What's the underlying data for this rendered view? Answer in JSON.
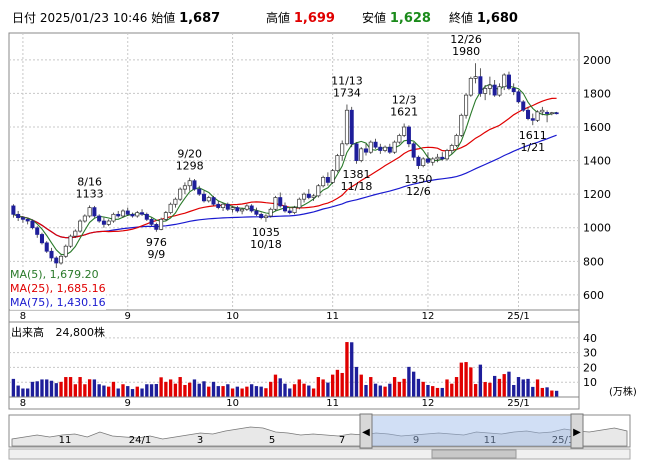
{
  "header": {
    "date_label": "日付",
    "datetime": "2025/01/23 10:46",
    "open_label": "始値",
    "open": "1,687",
    "high_label": "高値",
    "high": "1,699",
    "low_label": "安値",
    "low": "1,628",
    "close_label": "終値",
    "close": "1,680"
  },
  "colors": {
    "up": "#e00000",
    "down": "#1e1e9a",
    "ma5": "#2a7a2a",
    "ma25": "#e00000",
    "ma75": "#1a1ad0",
    "grid": "#c8c8c8",
    "high_value": "#e00000",
    "low_value": "#1a8a1a"
  },
  "chart_data": [
    {
      "type": "candlestick",
      "y_ticks": [
        "2000",
        "1800",
        "1600",
        "1400",
        "1200",
        "1000",
        "800",
        "600"
      ],
      "ylim": [
        510,
        2160
      ],
      "x_ticks": [
        "8",
        "9",
        "10",
        "11",
        "12",
        "25/1"
      ],
      "legend": [
        {
          "name": "MA(5)",
          "value": "1,679.20"
        },
        {
          "name": "MA(25)",
          "value": "1,685.16"
        },
        {
          "name": "MA(75)",
          "value": "1,430.16"
        }
      ],
      "annotations": [
        {
          "date": "8/16",
          "value": "1133"
        },
        {
          "date": "9/9",
          "value": "976"
        },
        {
          "date": "9/20",
          "value": "1298"
        },
        {
          "date": "10/18",
          "value": "1035"
        },
        {
          "date": "11/13",
          "value": "1734"
        },
        {
          "date": "11/18",
          "value": "1381"
        },
        {
          "date": "12/3",
          "value": "1621"
        },
        {
          "date": "12/6",
          "value": "1350"
        },
        {
          "date": "12/26",
          "value": "1980"
        },
        {
          "date": "1/21",
          "value": "1611"
        }
      ],
      "n_sessions": 115,
      "ohlc": [
        [
          1130,
          1140,
          1060,
          1080
        ],
        [
          1080,
          1100,
          1040,
          1060
        ],
        [
          1060,
          1070,
          1030,
          1050
        ],
        [
          1050,
          1060,
          1020,
          1040
        ],
        [
          1040,
          1050,
          990,
          1000
        ],
        [
          1000,
          1010,
          940,
          960
        ],
        [
          960,
          970,
          900,
          910
        ],
        [
          910,
          920,
          850,
          860
        ],
        [
          860,
          880,
          800,
          820
        ],
        [
          820,
          830,
          760,
          790
        ],
        [
          790,
          840,
          780,
          830
        ],
        [
          830,
          900,
          820,
          890
        ],
        [
          890,
          960,
          880,
          950
        ],
        [
          950,
          990,
          940,
          980
        ],
        [
          980,
          1050,
          970,
          1040
        ],
        [
          1040,
          1080,
          1030,
          1070
        ],
        [
          1070,
          1133,
          1060,
          1120
        ],
        [
          1120,
          1130,
          1060,
          1070
        ],
        [
          1070,
          1080,
          1030,
          1040
        ],
        [
          1040,
          1060,
          1000,
          1020
        ],
        [
          1020,
          1050,
          1010,
          1040
        ],
        [
          1040,
          1090,
          1030,
          1080
        ],
        [
          1080,
          1100,
          1060,
          1070
        ],
        [
          1070,
          1110,
          1060,
          1100
        ],
        [
          1100,
          1120,
          1070,
          1080
        ],
        [
          1080,
          1090,
          1060,
          1070
        ],
        [
          1070,
          1100,
          1060,
          1090
        ],
        [
          1090,
          1110,
          1070,
          1080
        ],
        [
          1080,
          1090,
          1040,
          1050
        ],
        [
          1050,
          1060,
          1010,
          1020
        ],
        [
          1020,
          1030,
          976,
          990
        ],
        [
          990,
          1060,
          985,
          1050
        ],
        [
          1050,
          1100,
          1040,
          1090
        ],
        [
          1090,
          1150,
          1080,
          1140
        ],
        [
          1140,
          1180,
          1120,
          1170
        ],
        [
          1170,
          1240,
          1160,
          1230
        ],
        [
          1230,
          1270,
          1200,
          1250
        ],
        [
          1250,
          1298,
          1220,
          1280
        ],
        [
          1280,
          1290,
          1220,
          1230
        ],
        [
          1230,
          1250,
          1190,
          1200
        ],
        [
          1200,
          1220,
          1150,
          1160
        ],
        [
          1160,
          1190,
          1150,
          1180
        ],
        [
          1180,
          1190,
          1130,
          1140
        ],
        [
          1140,
          1160,
          1110,
          1120
        ],
        [
          1120,
          1150,
          1100,
          1140
        ],
        [
          1140,
          1150,
          1100,
          1110
        ],
        [
          1110,
          1130,
          1090,
          1120
        ],
        [
          1120,
          1130,
          1090,
          1100
        ],
        [
          1100,
          1120,
          1080,
          1110
        ],
        [
          1110,
          1140,
          1100,
          1130
        ],
        [
          1130,
          1140,
          1090,
          1100
        ],
        [
          1100,
          1120,
          1070,
          1080
        ],
        [
          1080,
          1090,
          1050,
          1060
        ],
        [
          1060,
          1080,
          1035,
          1070
        ],
        [
          1070,
          1120,
          1060,
          1110
        ],
        [
          1110,
          1190,
          1100,
          1180
        ],
        [
          1180,
          1210,
          1120,
          1130
        ],
        [
          1130,
          1150,
          1090,
          1100
        ],
        [
          1100,
          1120,
          1080,
          1090
        ],
        [
          1090,
          1130,
          1080,
          1120
        ],
        [
          1120,
          1180,
          1110,
          1170
        ],
        [
          1170,
          1210,
          1150,
          1200
        ],
        [
          1200,
          1230,
          1170,
          1180
        ],
        [
          1180,
          1200,
          1160,
          1190
        ],
        [
          1190,
          1260,
          1180,
          1250
        ],
        [
          1250,
          1310,
          1240,
          1300
        ],
        [
          1300,
          1330,
          1250,
          1270
        ],
        [
          1270,
          1350,
          1260,
          1340
        ],
        [
          1340,
          1440,
          1330,
          1430
        ],
        [
          1430,
          1520,
          1400,
          1500
        ],
        [
          1500,
          1734,
          1490,
          1700
        ],
        [
          1700,
          1720,
          1480,
          1500
        ],
        [
          1500,
          1510,
          1381,
          1400
        ],
        [
          1400,
          1480,
          1390,
          1470
        ],
        [
          1470,
          1500,
          1430,
          1450
        ],
        [
          1450,
          1520,
          1440,
          1510
        ],
        [
          1510,
          1530,
          1470,
          1480
        ],
        [
          1480,
          1500,
          1440,
          1460
        ],
        [
          1460,
          1490,
          1450,
          1480
        ],
        [
          1480,
          1500,
          1440,
          1450
        ],
        [
          1450,
          1520,
          1440,
          1510
        ],
        [
          1510,
          1560,
          1500,
          1550
        ],
        [
          1550,
          1621,
          1540,
          1600
        ],
        [
          1600,
          1610,
          1480,
          1500
        ],
        [
          1500,
          1510,
          1400,
          1420
        ],
        [
          1420,
          1430,
          1350,
          1370
        ],
        [
          1370,
          1420,
          1360,
          1410
        ],
        [
          1410,
          1450,
          1380,
          1390
        ],
        [
          1390,
          1420,
          1370,
          1410
        ],
        [
          1410,
          1440,
          1390,
          1420
        ],
        [
          1420,
          1450,
          1400,
          1410
        ],
        [
          1410,
          1470,
          1400,
          1460
        ],
        [
          1460,
          1500,
          1440,
          1490
        ],
        [
          1490,
          1560,
          1480,
          1550
        ],
        [
          1550,
          1680,
          1540,
          1670
        ],
        [
          1670,
          1800,
          1650,
          1790
        ],
        [
          1790,
          1900,
          1780,
          1890
        ],
        [
          1890,
          1980,
          1860,
          1900
        ],
        [
          1900,
          1950,
          1780,
          1800
        ],
        [
          1800,
          1850,
          1760,
          1830
        ],
        [
          1830,
          1900,
          1790,
          1850
        ],
        [
          1850,
          1880,
          1780,
          1790
        ],
        [
          1790,
          1860,
          1780,
          1840
        ],
        [
          1840,
          1920,
          1820,
          1910
        ],
        [
          1910,
          1930,
          1820,
          1830
        ],
        [
          1830,
          1860,
          1790,
          1810
        ],
        [
          1810,
          1820,
          1740,
          1750
        ],
        [
          1750,
          1760,
          1690,
          1700
        ],
        [
          1700,
          1720,
          1640,
          1650
        ],
        [
          1650,
          1680,
          1611,
          1640
        ],
        [
          1640,
          1700,
          1630,
          1690
        ],
        [
          1690,
          1720,
          1670,
          1700
        ],
        [
          1687,
          1699,
          1628,
          1680
        ],
        [
          1680,
          1690,
          1670,
          1685
        ],
        [
          1685,
          1690,
          1675,
          1680
        ]
      ]
    },
    {
      "type": "bar",
      "title": "出来高",
      "current": "24,800株",
      "y_ticks": [
        "40",
        "30",
        "20",
        "10"
      ],
      "unit": "(万株)",
      "ylim": [
        0,
        48
      ]
    },
    {
      "type": "area",
      "x_ticks": [
        "11",
        "24/1",
        "3",
        "5",
        "7",
        "9",
        "11",
        "25/1"
      ],
      "values": [
        1,
        3,
        5,
        3,
        5,
        6,
        3,
        8,
        4,
        3,
        2,
        4,
        1,
        3,
        5,
        7,
        6,
        9,
        11,
        13,
        12,
        8,
        7,
        5,
        6,
        5,
        4,
        6,
        5,
        7,
        6,
        4,
        5,
        6,
        7,
        6,
        5,
        8,
        7,
        6,
        8,
        9,
        7,
        8,
        11,
        9,
        8,
        10,
        12,
        9
      ]
    }
  ]
}
